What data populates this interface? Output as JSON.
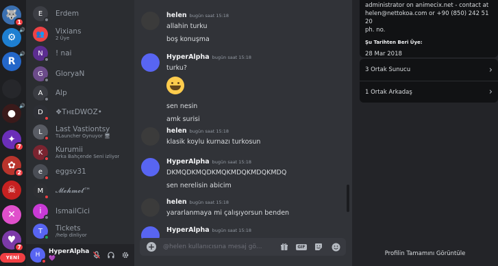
{
  "rail": {
    "servers": [
      {
        "name": "wolf-server",
        "color": "#3a6fb0",
        "glyph": "🐺",
        "badge": "1"
      },
      {
        "name": "gaming-server",
        "color": "#1e7fd1",
        "glyph": "⚙",
        "speaker": "🔊"
      },
      {
        "name": "rockbox-server",
        "color": "#2467c9",
        "glyph": "R",
        "speaker": "🔊"
      },
      {
        "name": "dark-server",
        "color": "#26272b",
        "glyph": ""
      },
      {
        "name": "red-orb-server",
        "color": "#3a1a1a",
        "glyph": "●",
        "speaker": "🔊"
      },
      {
        "name": "purple-server",
        "color": "#6b2fb8",
        "glyph": "✦",
        "badge": "7"
      },
      {
        "name": "anime-server",
        "color": "#b8342c",
        "glyph": "✿",
        "badge": "2"
      },
      {
        "name": "demon-server",
        "color": "#c62121",
        "glyph": "☠"
      },
      {
        "name": "pink-x-server",
        "color": "#e04fcb",
        "glyph": "✕"
      },
      {
        "name": "girl-server",
        "color": "#7c3aa8",
        "glyph": "♥",
        "badge": "7"
      }
    ],
    "new_label": "YENİ"
  },
  "dms": [
    {
      "name": "Erdem",
      "sub": "",
      "color": "#3c3e44",
      "status": "off",
      "glyph": "E"
    },
    {
      "name": "Vixians",
      "sub": "2 Üye",
      "color": "#ed4245",
      "status": "",
      "glyph": "👥"
    },
    {
      "name": "! nai",
      "sub": "",
      "color": "#5c2d91",
      "status": "off",
      "glyph": "N"
    },
    {
      "name": "GloryaN",
      "sub": "",
      "color": "#6c4b8a",
      "status": "off",
      "glyph": "G"
    },
    {
      "name": "Alp",
      "sub": "",
      "color": "#3a3c42",
      "status": "off",
      "glyph": "A"
    },
    {
      "name": "❖TʜᴇDWOZ•",
      "sub": "",
      "color": "#2d2f35",
      "status": "dnd",
      "glyph": "D"
    },
    {
      "name": "Last Vastiontsy",
      "sub": "TLauncher Oynuyor 🖥",
      "color": "#585b63",
      "status": "dnd",
      "glyph": "L"
    },
    {
      "name": "Kurumii",
      "sub": "Arka Bahçende Seni izliyor",
      "color": "#7a2430",
      "status": "dnd",
      "glyph": "K"
    },
    {
      "name": "eggsv31",
      "sub": "",
      "color": "#4a4d55",
      "status": "dnd",
      "glyph": "e"
    },
    {
      "name": "𝓜𝓮𝓱𝓶𝓮𝓽™",
      "sub": "",
      "color": "#2e2f33",
      "status": "dnd",
      "glyph": "M"
    },
    {
      "name": "İsmailCici",
      "sub": "",
      "color": "#c93ad6",
      "status": "off",
      "glyph": "İ"
    },
    {
      "name": "Tickets",
      "sub": "/help dinliyor",
      "color": "#5865f2",
      "status": "on",
      "glyph": "T"
    }
  ],
  "user_panel": {
    "name": "HyperAlpha",
    "status_emoji": "💜",
    "icons": [
      "mic-muted-icon",
      "headphones-icon",
      "settings-gear-icon"
    ]
  },
  "chat": {
    "messages": [
      {
        "author": "helen",
        "time": "bugün saat 15:18",
        "color": "#3b3b3b",
        "lines": [
          "allahin turku",
          "boş konuşma"
        ],
        "emoji": false
      },
      {
        "author": "HyperAlpha",
        "time": "bugün saat 15:18",
        "color": "#5865f2",
        "lines": [
          "turku?"
        ],
        "emoji": true,
        "after_emoji": [
          "sen nesin",
          "amk surisi"
        ]
      },
      {
        "author": "helen",
        "time": "bugün saat 15:18",
        "color": "#3b3b3b",
        "lines": [
          "klasik koylu kurnazı turkosun"
        ],
        "emoji": false
      },
      {
        "author": "HyperAlpha",
        "time": "bugün saat 15:18",
        "color": "#5865f2",
        "lines": [
          "DKMQDKMQDKMQKMDQKMDQKMDQ",
          "sen nerelisin abicim"
        ],
        "emoji": false
      },
      {
        "author": "helen",
        "time": "bugün saat 15:18",
        "color": "#3b3b3b",
        "lines": [
          "yararlanmaya mi çalışıyorsun benden"
        ],
        "emoji": false
      },
      {
        "author": "HyperAlpha",
        "time": "bugün saat 15:18",
        "color": "#5865f2",
        "lines": [],
        "emoji": false
      }
    ],
    "composer_placeholder": "@helen kullanıcısına mesaj gö...",
    "composer_gif": "GIF"
  },
  "profile": {
    "about_lines": [
      "administrator on animecix.net - contact at",
      "helen@nettokoa.com or +90 (850) 242 51 20",
      "ph. no."
    ],
    "since_label": "Şu Tarihten Beri Üye:",
    "since_date": "28 Mar 2018",
    "mutual_servers": "3 Ortak Sunucu",
    "mutual_friends": "1 Ortak Arkadaş",
    "view_full": "Profilin Tamamını Görüntüle"
  }
}
